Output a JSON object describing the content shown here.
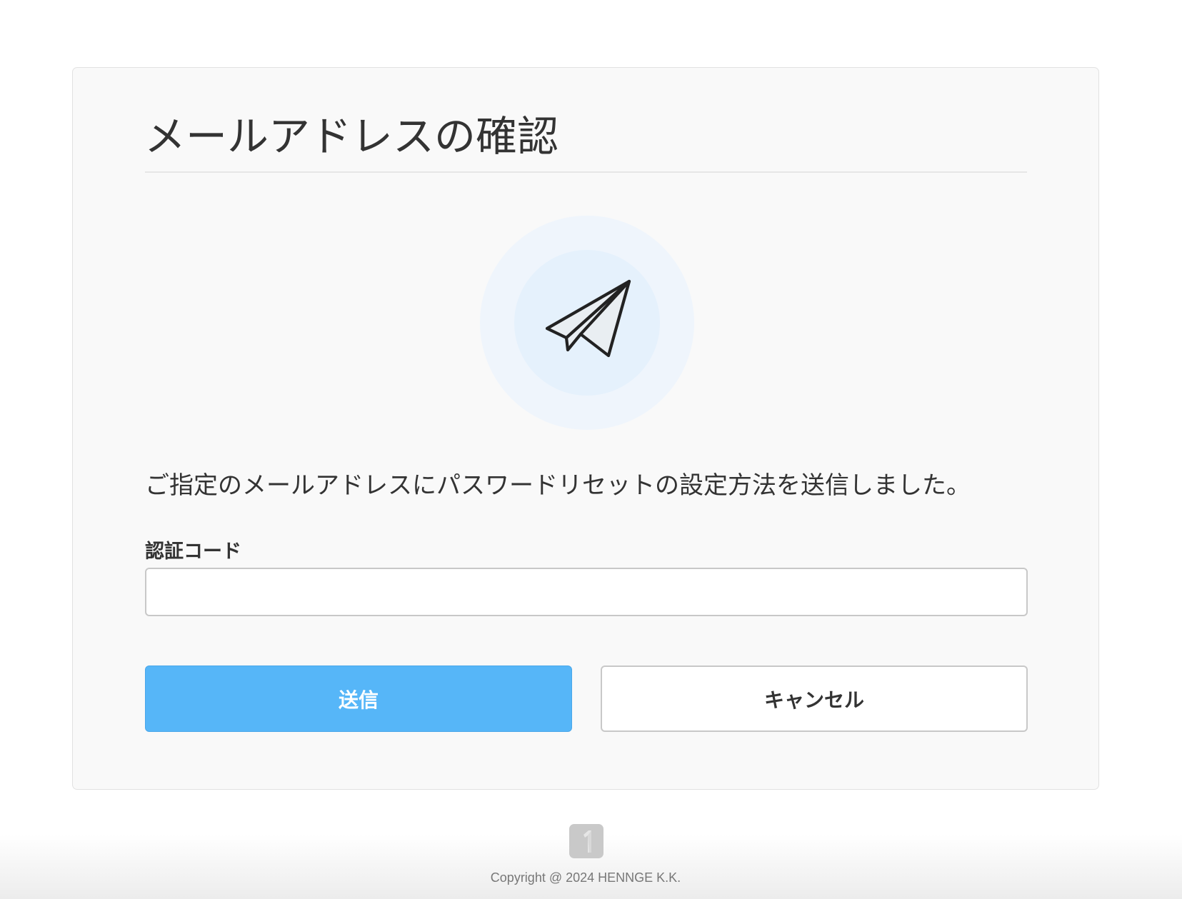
{
  "page": {
    "title": "メールアドレスの確認",
    "message": "ご指定のメールアドレスにパスワードリセットの設定方法を送信しました。"
  },
  "form": {
    "code_label": "認証コード",
    "code_value": "",
    "code_placeholder": "",
    "submit_label": "送信",
    "cancel_label": "キャンセル"
  },
  "icons": {
    "hero": "paper-plane-icon",
    "footer": "henngeone-logo-icon"
  },
  "footer": {
    "copyright": "Copyright @ 2024 HENNGE K.K."
  },
  "colors": {
    "primary_button": "#56b6f8",
    "card_background": "#f9f9f9",
    "icon_circle_outer": "#eff5fc",
    "icon_circle_inner": "#e5f1fc",
    "text": "#333333"
  }
}
